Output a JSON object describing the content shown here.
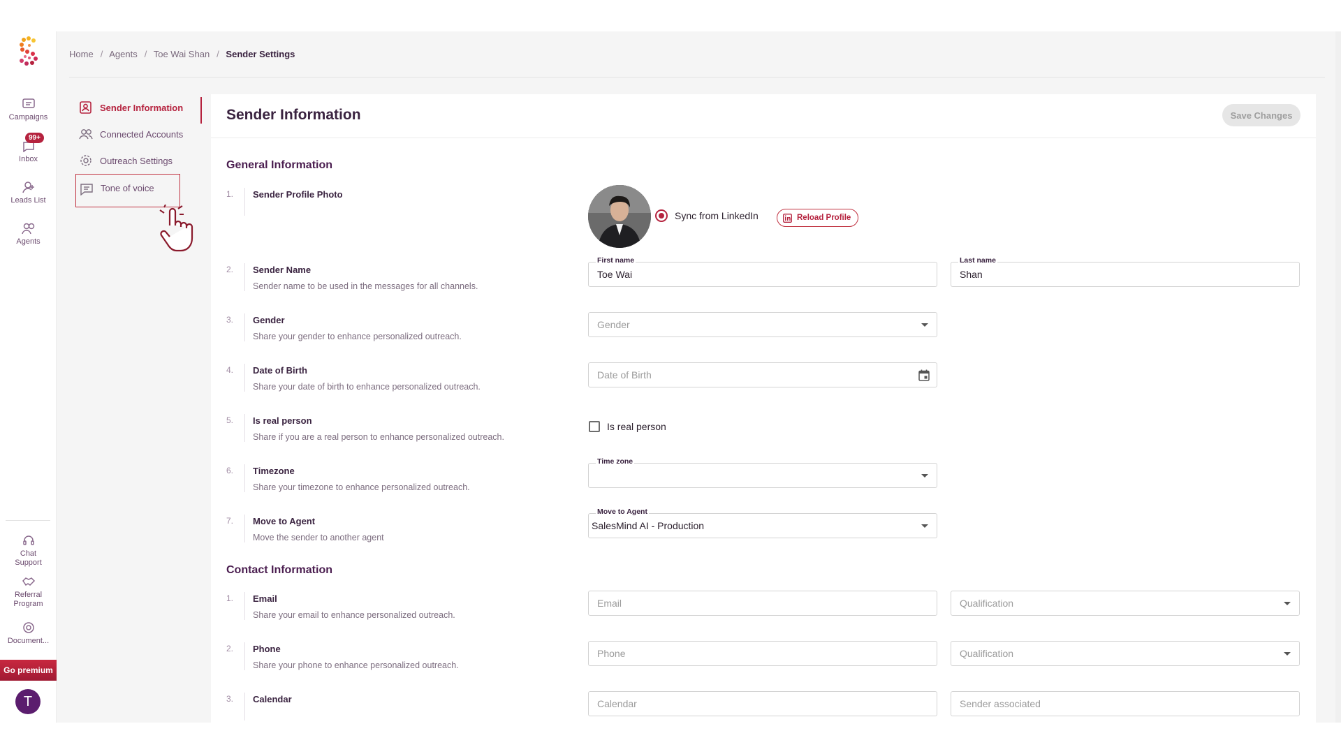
{
  "rail": {
    "items": [
      {
        "label": "Campaigns",
        "icon": "campaigns-icon"
      },
      {
        "label": "Inbox",
        "icon": "inbox-icon",
        "badge": "99+"
      },
      {
        "label": "Leads List",
        "icon": "leads-list-icon"
      },
      {
        "label": "Agents",
        "icon": "agents-icon"
      }
    ],
    "bottom_items": [
      {
        "label_line1": "Chat",
        "label_line2": "Support",
        "icon": "headset-icon"
      },
      {
        "label_line1": "Referral",
        "label_line2": "Program",
        "icon": "handshake-icon"
      },
      {
        "label_line1": "Document...",
        "label_line2": "",
        "icon": "help-icon"
      }
    ],
    "premium_label": "Go premium",
    "avatar_initial": "T"
  },
  "breadcrumb": [
    "Home",
    "Agents",
    "Toe Wai Shan",
    "Sender Settings"
  ],
  "subnav": [
    {
      "label": "Sender Information",
      "icon": "user-card-icon",
      "active": true
    },
    {
      "label": "Connected Accounts",
      "icon": "people-icon"
    },
    {
      "label": "Outreach Settings",
      "icon": "gear-icon"
    },
    {
      "label": "Tone of voice",
      "icon": "message-icon"
    }
  ],
  "card": {
    "title": "Sender Information",
    "save_label": "Save Changes"
  },
  "general": {
    "title": "General Information",
    "rows": [
      {
        "num": "1.",
        "label": "Sender Profile Photo",
        "desc": ""
      },
      {
        "num": "2.",
        "label": "Sender Name",
        "desc": "Sender name to be used in the messages for all channels."
      },
      {
        "num": "3.",
        "label": "Gender",
        "desc": "Share your gender to enhance personalized outreach."
      },
      {
        "num": "4.",
        "label": "Date of Birth",
        "desc": "Share your date of birth to enhance personalized outreach."
      },
      {
        "num": "5.",
        "label": "Is real person",
        "desc": "Share if you are a real person to enhance personalized outreach."
      },
      {
        "num": "6.",
        "label": "Timezone",
        "desc": "Share your timezone to enhance personalized outreach."
      },
      {
        "num": "7.",
        "label": "Move to Agent",
        "desc": "Move the sender to another agent"
      }
    ],
    "sync_label": "Sync from LinkedIn",
    "reload_label": "Reload Profile",
    "first_name_label": "First name",
    "first_name_value": "Toe Wai",
    "last_name_label": "Last name",
    "last_name_value": "Shan",
    "gender_placeholder": "Gender",
    "dob_placeholder": "Date of Birth",
    "real_person_label": "Is real person",
    "real_person_checked": false,
    "timezone_label": "Time zone",
    "timezone_value": "",
    "move_agent_label": "Move to Agent",
    "move_agent_value": "SalesMind AI - Production"
  },
  "contact": {
    "title": "Contact Information",
    "rows": [
      {
        "num": "1.",
        "label": "Email",
        "desc": "Share your email to enhance personalized outreach."
      },
      {
        "num": "2.",
        "label": "Phone",
        "desc": "Share your phone to enhance personalized outreach."
      },
      {
        "num": "3.",
        "label": "Calendar",
        "desc": ""
      }
    ],
    "email_placeholder": "Email",
    "phone_placeholder": "Phone",
    "calendar_placeholder": "Calendar",
    "qualification_placeholder": "Qualification",
    "sender_associated_placeholder": "Sender associated"
  },
  "colors": {
    "accent": "#b5223e",
    "heading": "#4a1d4f",
    "avatar": "#5b1d6e"
  }
}
